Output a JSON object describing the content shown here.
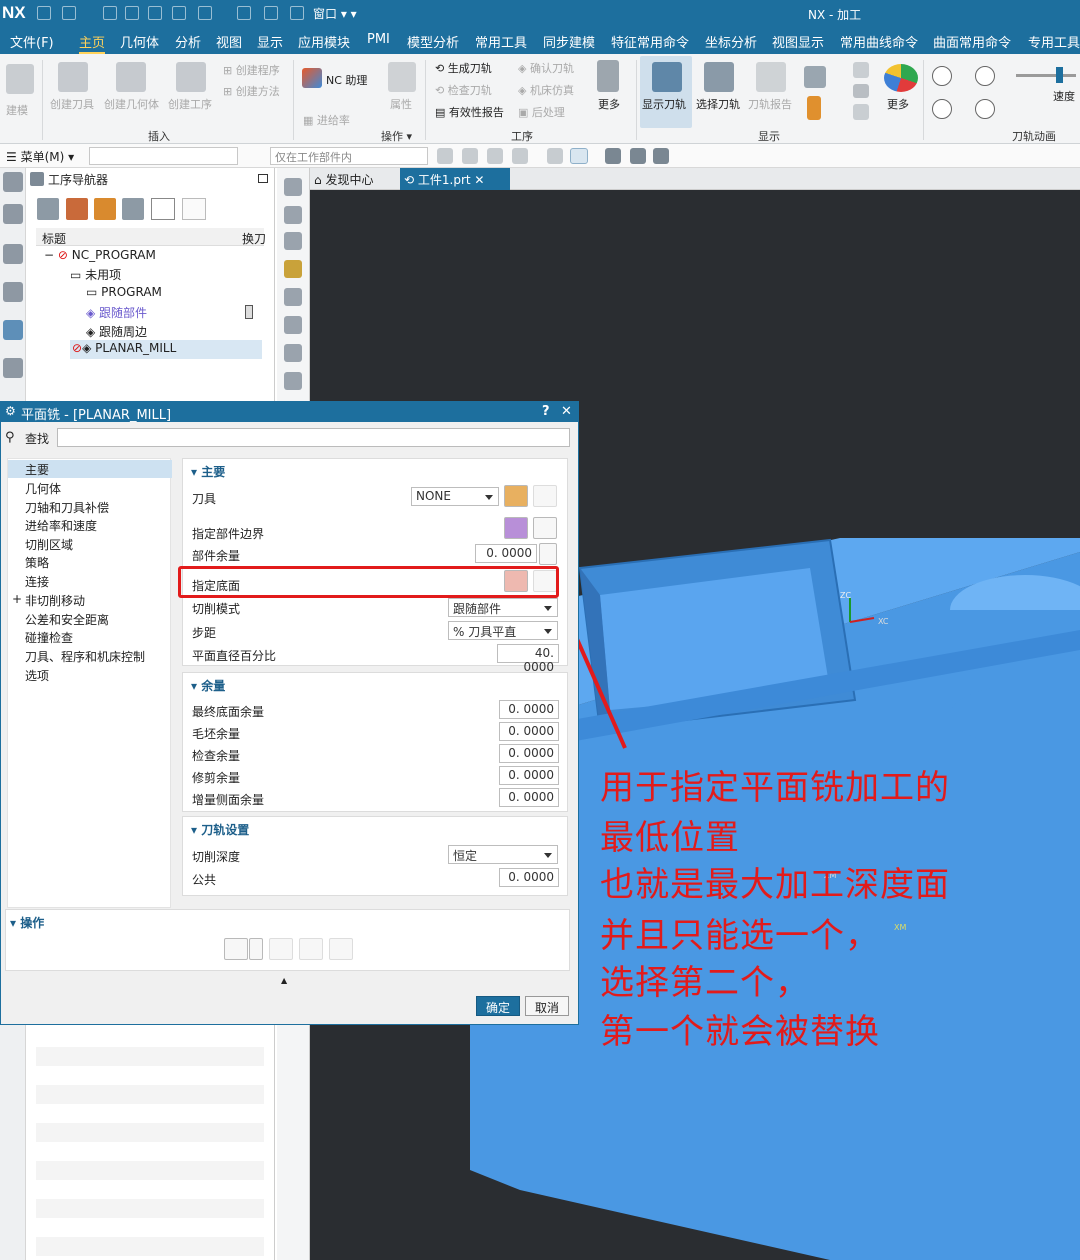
{
  "app": {
    "logo": "NX",
    "title": "NX - 加工",
    "window_menu": "窗口"
  },
  "menu_tabs": [
    "文件(F)",
    "主页",
    "几何体",
    "分析",
    "视图",
    "显示",
    "应用模块",
    "PMI",
    "模型分析",
    "常用工具",
    "同步建模",
    "特征常用命令",
    "坐标分析",
    "视图显示",
    "常用曲线命令",
    "曲面常用命令",
    "专用工具"
  ],
  "active_tab": "主页",
  "ribbon": {
    "buttons": {
      "b0": "建模",
      "b1": "创建刀具",
      "b2": "创建几何体",
      "b3": "创建工序",
      "b4": "创建程序",
      "b5": "创建方法",
      "b6": "NC 助理",
      "b7": "属性",
      "b8": "进给率",
      "b9": "生成刀轨",
      "b10": "检查刀轨",
      "b11": "有效性报告",
      "b12": "确认刀轨",
      "b13": "机床仿真",
      "b14": "后处理",
      "b15": "更多",
      "b16": "显示刀轨",
      "b17": "选择刀轨",
      "b18": "刀轨报告",
      "b19": "更多",
      "b20": "速度"
    },
    "groups": {
      "insert": "插入",
      "operation": "操作",
      "process": "工序",
      "display": "显示",
      "animation": "刀轨动画"
    }
  },
  "toolbar2": {
    "menu": "菜单(M)",
    "filter": "仅在工作部件内"
  },
  "navigator": {
    "title": "工序导航器",
    "col_title": "标题",
    "col_tool": "换刀",
    "rows": [
      "NC_PROGRAM",
      "未用项",
      "PROGRAM",
      "跟随部件",
      "跟随周边",
      "PLANAR_MILL"
    ]
  },
  "tabs": {
    "discovery": "发现中心",
    "part": "工件1.prt"
  },
  "axes": {
    "zc": "ZC",
    "xc": "XC",
    "zm": "ZM",
    "xm": "XM"
  },
  "dialog": {
    "title": "平面铣 - [PLANAR_MILL]",
    "help": "?",
    "close": "✕",
    "search_label": "查找",
    "left_items": [
      "主要",
      "几何体",
      "刀轴和刀具补偿",
      "进给率和速度",
      "切削区域",
      "策略",
      "连接",
      "非切削移动",
      "公差和安全距离",
      "碰撞检查",
      "刀具、程序和机床控制",
      "选项"
    ],
    "main": {
      "title": "主要",
      "tool_label": "刀具",
      "tool_value": "NONE",
      "part_boundary": "指定部件边界",
      "part_stock_label": "部件余量",
      "part_stock_value": "0. 0000",
      "floor_label": "指定底面",
      "cut_pattern_label": "切削模式",
      "cut_pattern_value": "跟随部件",
      "stepover_label": "步距",
      "stepover_value": "% 刀具平直",
      "percent_label": "平面直径百分比",
      "percent_value": "40. 0000"
    },
    "stock": {
      "title": "余量",
      "rows": [
        {
          "label": "最终底面余量",
          "value": "0. 0000"
        },
        {
          "label": "毛坯余量",
          "value": "0. 0000"
        },
        {
          "label": "检查余量",
          "value": "0. 0000"
        },
        {
          "label": "修剪余量",
          "value": "0. 0000"
        },
        {
          "label": "增量侧面余量",
          "value": "0. 0000"
        }
      ]
    },
    "path": {
      "title": "刀轨设置",
      "depth_label": "切削深度",
      "depth_value": "恒定",
      "common_label": "公共",
      "common_value": "0. 0000"
    },
    "ops_title": "操作",
    "ok": "确定",
    "cancel": "取消"
  },
  "annotation": [
    "用于指定平面铣加工的",
    "最低位置",
    "也就是最大加工深度面",
    "并且只能选一个，",
    "选择第二个，",
    "第一个就会被替换"
  ]
}
